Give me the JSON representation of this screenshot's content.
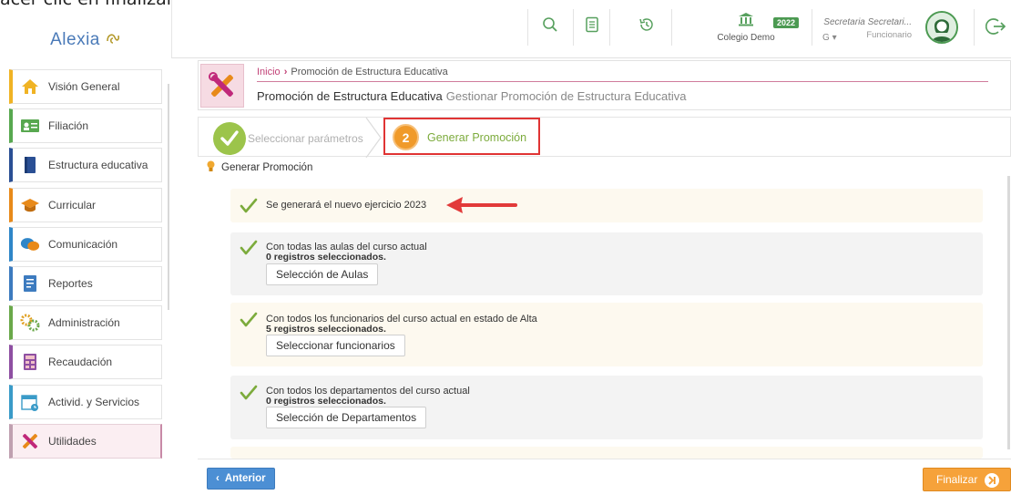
{
  "caption": "acer clic en finalizar luego de revisar.",
  "app": {
    "logo_text": "Alexia"
  },
  "header": {
    "school_name": "Colegio Demo",
    "year_badge": "2022",
    "user_name": "Secretaria Secretari...",
    "user_role": "Funcionario",
    "user_initial": "G",
    "user_dropdown_mark": "▾",
    "icons": [
      "search-icon",
      "document-icon",
      "history-icon",
      "building-icon",
      "logout-icon"
    ],
    "accent": "#4c9a52"
  },
  "sidebar": {
    "items": [
      {
        "label": "Visión General",
        "icon": "home-icon",
        "color": "#f0b324"
      },
      {
        "label": "Filiación",
        "icon": "contact-card-icon",
        "color": "#58a850"
      },
      {
        "label": "Estructura educativa",
        "icon": "book-icon",
        "color": "#2a4f94"
      },
      {
        "label": "Curricular",
        "icon": "graduation-cap-icon",
        "color": "#e88a1a"
      },
      {
        "label": "Comunicación",
        "icon": "chat-bubbles-icon",
        "color": "#2f86c8"
      },
      {
        "label": "Reportes",
        "icon": "report-icon",
        "color": "#3d7bbf"
      },
      {
        "label": "Administración",
        "icon": "gears-icon",
        "color": "#6aa84a"
      },
      {
        "label": "Recaudación",
        "icon": "calculator-icon",
        "color": "#8e4fa2"
      },
      {
        "label": "Activid. y Servicios",
        "icon": "calendar-icon",
        "color": "#3a9bc8"
      },
      {
        "label": "Utilidades",
        "icon": "tools-icon",
        "color": "#c0287a"
      }
    ],
    "active_index": 9
  },
  "breadcrumb": {
    "home": "Inicio",
    "separator": "›",
    "current": "Promoción de Estructura Educativa"
  },
  "page": {
    "title": "Promoción de Estructura Educativa",
    "subtitle": "Gestionar Promoción de Estructura Educativa"
  },
  "wizard": {
    "step1_label": "Seleccionar parámetros",
    "step2_number": "2",
    "step2_label": "Generar Promoción"
  },
  "section": {
    "title": "Generar Promoción"
  },
  "blocks": {
    "b1_text": "Se generará el nuevo ejercicio 2023",
    "b2_text": "Con todas las aulas del curso actual",
    "b2_count": "0 registros seleccionados.",
    "b2_button": "Selección de Aulas",
    "b3_text": "Con todos los funcionarios del curso actual en estado de Alta",
    "b3_count": "5 registros seleccionados.",
    "b3_button": "Seleccionar funcionarios",
    "b4_text": "Con todos los departamentos del curso actual",
    "b4_count": "0 registros seleccionados.",
    "b4_button": "Selección de Departamentos"
  },
  "footer": {
    "prev_label": "Anterior",
    "finish_label": "Finalizar"
  }
}
